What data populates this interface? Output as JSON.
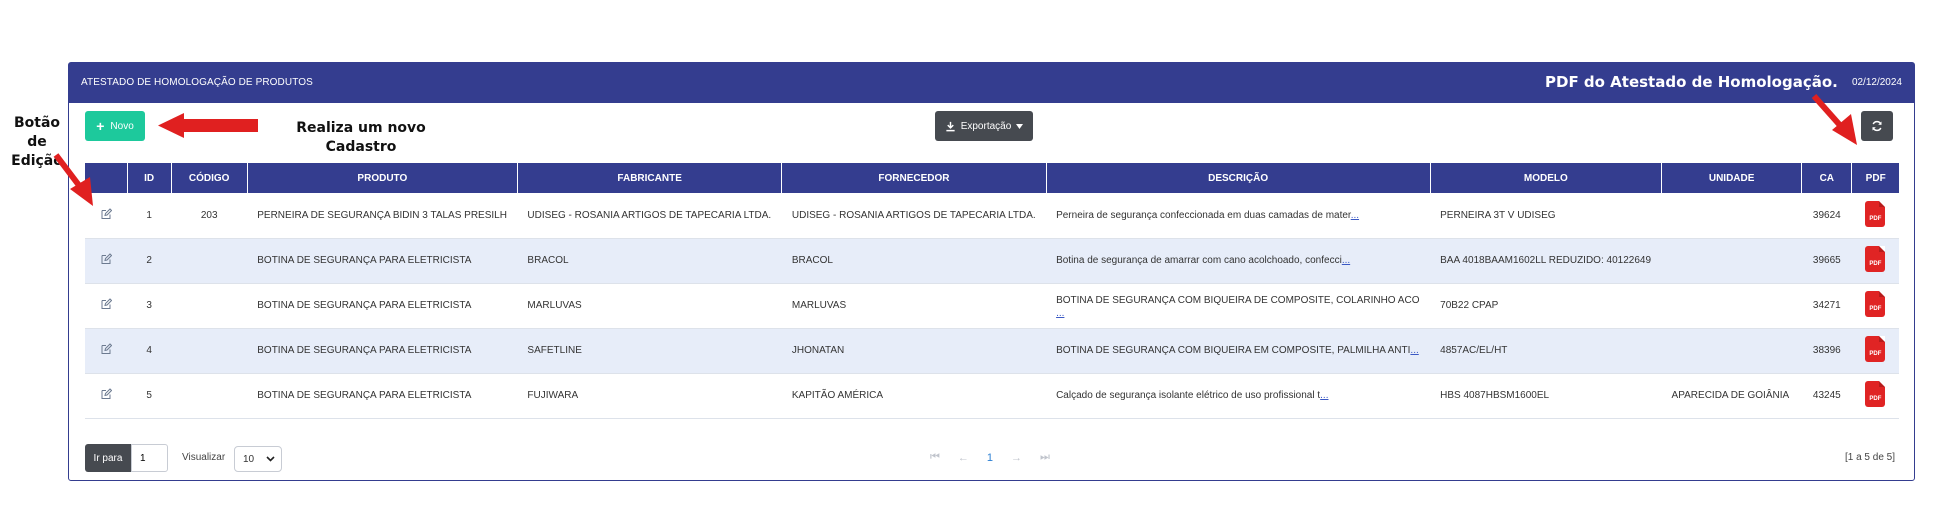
{
  "header": {
    "title": "ATESTADO DE HOMOLOGAÇÃO DE PRODUTOS",
    "date": "02/12/2024"
  },
  "toolbar": {
    "novo_label": "Novo",
    "export_label": "Exportação"
  },
  "annotations": {
    "edit": "Botão de Edição",
    "novo": "Realiza um novo Cadastro",
    "pdf": "PDF do Atestado de Homologação."
  },
  "table": {
    "columns": [
      "",
      "ID",
      "CÓDIGO",
      "PRODUTO",
      "FABRICANTE",
      "FORNECEDOR",
      "DESCRIÇÃO",
      "MODELO",
      "UNIDADE",
      "CA",
      "PDF"
    ],
    "rows": [
      {
        "id": "1",
        "codigo": "203",
        "produto": "PERNEIRA DE SEGURANÇA BIDIN 3 TALAS PRESILH",
        "fabricante": "UDISEG - ROSANIA ARTIGOS DE TAPECARIA LTDA.",
        "fornecedor": "UDISEG - ROSANIA ARTIGOS DE TAPECARIA LTDA.",
        "descricao": "Perneira de segurança confeccionada em duas camadas de mater",
        "modelo": "PERNEIRA 3T V UDISEG",
        "unidade": "",
        "ca": "39624"
      },
      {
        "id": "2",
        "codigo": "",
        "produto": "BOTINA DE SEGURANÇA PARA ELETRICISTA",
        "fabricante": "BRACOL",
        "fornecedor": "BRACOL",
        "descricao": "Botina de segurança de amarrar com cano acolchoado, confecci",
        "modelo": "BAA 4018BAAM1602LL REDUZIDO: 40122649",
        "unidade": "",
        "ca": "39665"
      },
      {
        "id": "3",
        "codigo": "",
        "produto": "BOTINA DE SEGURANÇA PARA ELETRICISTA",
        "fabricante": "MARLUVAS",
        "fornecedor": "MARLUVAS",
        "descricao": "BOTINA DE SEGURANÇA COM BIQUEIRA DE COMPOSITE, COLARINHO ACO",
        "modelo": "70B22 CPAP",
        "unidade": "",
        "ca": "34271"
      },
      {
        "id": "4",
        "codigo": "",
        "produto": "BOTINA DE SEGURANÇA PARA ELETRICISTA",
        "fabricante": "SAFETLINE",
        "fornecedor": "JHONATAN",
        "descricao": "BOTINA DE SEGURANÇA COM BIQUEIRA EM COMPOSITE, PALMILHA ANTI",
        "modelo": "4857AC/EL/HT",
        "unidade": "",
        "ca": "38396"
      },
      {
        "id": "5",
        "codigo": "",
        "produto": "BOTINA DE SEGURANÇA PARA ELETRICISTA",
        "fabricante": "FUJIWARA",
        "fornecedor": "KAPITÃO AMÉRICA",
        "descricao": "Calçado de segurança isolante elétrico de uso profissional t",
        "modelo": "HBS 4087HBSM1600EL",
        "unidade": "APARECIDA DE GOIÂNIA",
        "ca": "43245"
      }
    ],
    "more_link": "..."
  },
  "pager": {
    "goto_label": "Ir para",
    "goto_value": "1",
    "view_label": "Visualizar",
    "page_size": "10",
    "current_page": "1",
    "info": "[1 a 5 de 5]"
  },
  "colors": {
    "header": "#343d8f",
    "novo": "#1dc99c",
    "dark_button": "#464a50",
    "alt_row": "#e7edf9",
    "pdf": "#e02424",
    "arrow": "#e02020"
  }
}
